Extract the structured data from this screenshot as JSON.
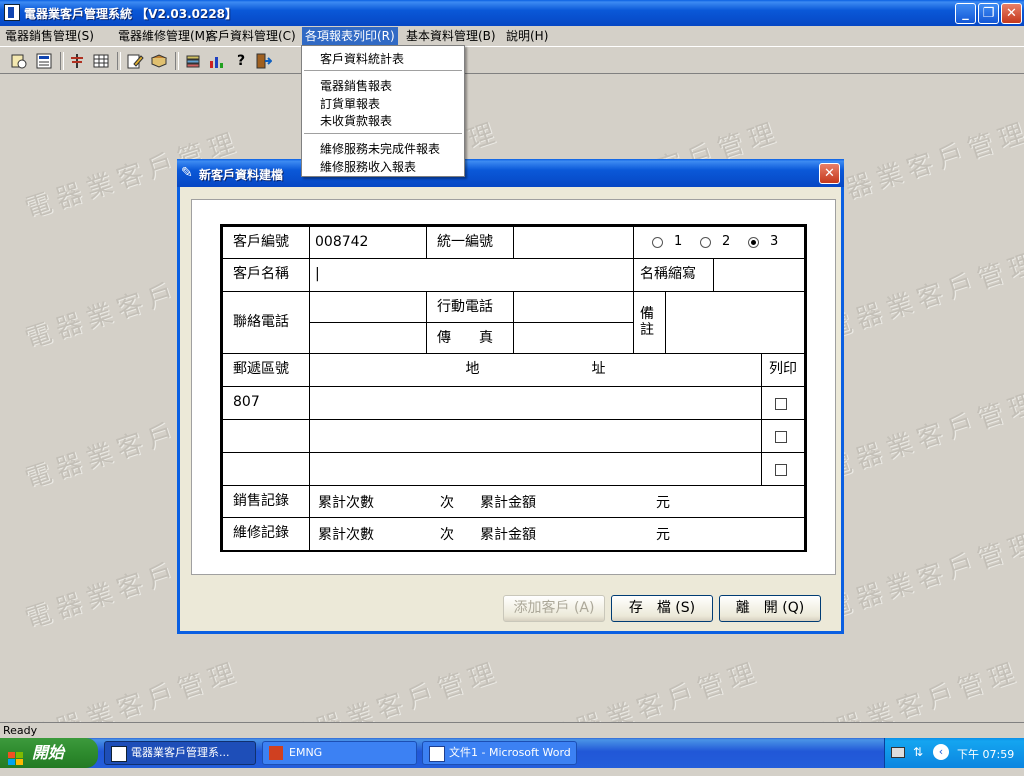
{
  "window": {
    "title": "電器業客戶管理系統 【V2.03.0228】",
    "minimize": "_",
    "maximize": "❐",
    "close": "✕"
  },
  "menu": [
    {
      "label": "電器銷售管理(S)"
    },
    {
      "label": "電器維修管理(M)"
    },
    {
      "label": "客戶資料管理(C)"
    },
    {
      "label": "各項報表列印(R)"
    },
    {
      "label": "基本資料管理(B)"
    },
    {
      "label": "說明(H)"
    }
  ],
  "dropdown": {
    "items": [
      {
        "label": "客戶資料統計表"
      },
      {
        "label": "電器銷售報表"
      },
      {
        "label": "訂貨單報表"
      },
      {
        "label": "未收貨款報表"
      },
      {
        "label": "維修服務未完成件報表"
      },
      {
        "label": "維修服務收入報表"
      }
    ]
  },
  "toolbar": {
    "icons": [
      "customer-list-icon",
      "report-icon",
      "cut-icon",
      "grid-icon",
      "edit-icon",
      "book-icon",
      "stack-icon",
      "chart-icon",
      "help-icon",
      "exit-icon"
    ]
  },
  "watermark": {
    "text": "電器業客戶管理"
  },
  "dialog": {
    "title": "新客戶資料建檔",
    "close": "✕",
    "form": {
      "customer_id_label": "客戶編號",
      "customer_id_value": "008742",
      "tax_id_label": "統一編號",
      "tax_id_value": "",
      "radio_options": [
        "1",
        "2",
        "3"
      ],
      "radio_selected": "3",
      "customer_name_label": "客戶名稱",
      "customer_name_value": "|",
      "short_name_label": "名稱縮寫",
      "short_name_value": "",
      "phone_label": "聯絡電話",
      "mobile_label": "行動電話",
      "fax_label": "傳　　真",
      "remarks_label": "備註",
      "zip_label": "郵遞區號",
      "address_label": "地　　　　　　　　址",
      "print_label": "列印",
      "address_rows": [
        {
          "zip": "807",
          "address": ""
        },
        {
          "zip": "",
          "address": ""
        },
        {
          "zip": "",
          "address": ""
        }
      ],
      "sales_label": "銷售記錄",
      "repair_label": "維修記錄",
      "count_label": "累計次數",
      "count_unit": "次",
      "amount_label": "累計金額",
      "amount_unit": "元"
    },
    "buttons": {
      "add_customer": "添加客戶 (A)",
      "save": "存　檔 (S)",
      "leave": "離　開 (Q)"
    }
  },
  "statusbar": {
    "text": "Ready"
  },
  "taskbar": {
    "start": "開始",
    "tasks": [
      {
        "label": "電器業客戶管理系...",
        "active": true
      },
      {
        "label": "EMNG",
        "active": false
      },
      {
        "label": "文件1 - Microsoft Word",
        "active": false
      }
    ],
    "clock": "下午 07:59"
  },
  "colors": {
    "titlebar": "#0a5fe2",
    "menu_highlight": "#316ac5",
    "workspace": "#d4d0c8",
    "taskbar": "#245edb",
    "start_button": "#2e8b2e"
  }
}
